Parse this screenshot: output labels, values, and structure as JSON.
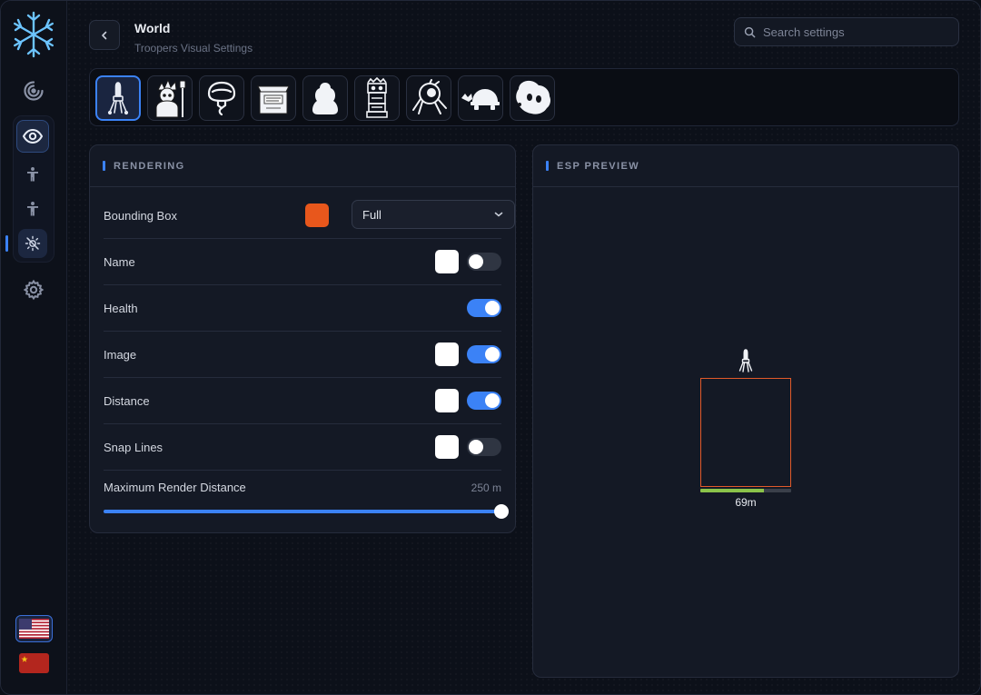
{
  "header": {
    "title": "World",
    "subtitle": "Troopers Visual Settings"
  },
  "search": {
    "placeholder": "Search settings",
    "value": ""
  },
  "sidebar": {
    "items": [
      {
        "icon": "radar-icon"
      },
      {
        "icon": "eye-icon",
        "active": true
      },
      {
        "icon": "person-icon"
      },
      {
        "icon": "person-icon"
      },
      {
        "icon": "world-sun-icon",
        "selected": true
      },
      {
        "icon": "gear-icon"
      }
    ],
    "languages": [
      "us-flag-icon",
      "china-flag-icon"
    ]
  },
  "characters": [
    {
      "name": "trooper-icon",
      "selected": true
    },
    {
      "name": "bandit-icon"
    },
    {
      "name": "mask-icon"
    },
    {
      "name": "crate-icon"
    },
    {
      "name": "ghost-icon"
    },
    {
      "name": "totem-icon"
    },
    {
      "name": "crawler-icon"
    },
    {
      "name": "turtle-icon"
    },
    {
      "name": "blob-icon"
    }
  ],
  "rendering": {
    "title": "RENDERING",
    "rows": [
      {
        "label": "Bounding Box",
        "color": "#e8571c",
        "select": "Full"
      },
      {
        "label": "Name",
        "color": "#ffffff",
        "toggle": false
      },
      {
        "label": "Health",
        "toggle": true
      },
      {
        "label": "Image",
        "color": "#ffffff",
        "toggle": true
      },
      {
        "label": "Distance",
        "color": "#ffffff",
        "toggle": true
      },
      {
        "label": "Snap Lines",
        "color": "#ffffff",
        "toggle": false
      }
    ],
    "slider": {
      "label": "Maximum Render Distance",
      "value": "250 m",
      "fraction": 1.0
    }
  },
  "preview": {
    "title": "ESP PREVIEW",
    "distance": "69m",
    "health_fraction": 0.7,
    "box_color": "#e15a2a"
  }
}
